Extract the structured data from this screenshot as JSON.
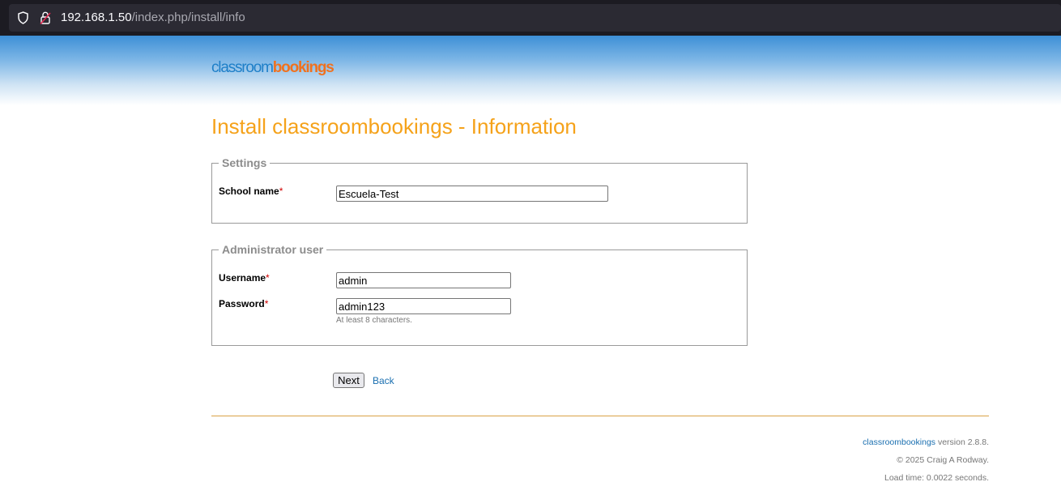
{
  "browser": {
    "url_host": "192.168.1.50",
    "url_path": "/index.php/install/info",
    "icons": [
      "shield-icon",
      "lock-icon"
    ]
  },
  "header": {
    "logo_part1": "classroom",
    "logo_part2": "bookings"
  },
  "page": {
    "title": "Install classroombookings - Information"
  },
  "settings": {
    "legend": "Settings",
    "school_name_label": "School name",
    "school_name_value": "Escuela-Test"
  },
  "admin": {
    "legend": "Administrator user",
    "username_label": "Username",
    "username_value": "admin",
    "password_label": "Password",
    "password_value": "admin123",
    "password_hint": "At least 8 characters."
  },
  "required_marker": "*",
  "actions": {
    "next_label": "Next",
    "back_label": "Back"
  },
  "footer": {
    "app_link": "classroombookings",
    "version_text": " version 2.8.8.",
    "copyright": "© 2025 Craig A Rodway.",
    "load_time": "Load time: 0.0022 seconds."
  },
  "colors": {
    "title": "#f5a21a",
    "logo_blue": "#1e7fc8",
    "logo_orange": "#f0711e",
    "link": "#1a6fb0",
    "divider": "#d9a246",
    "required": "#d10000"
  }
}
